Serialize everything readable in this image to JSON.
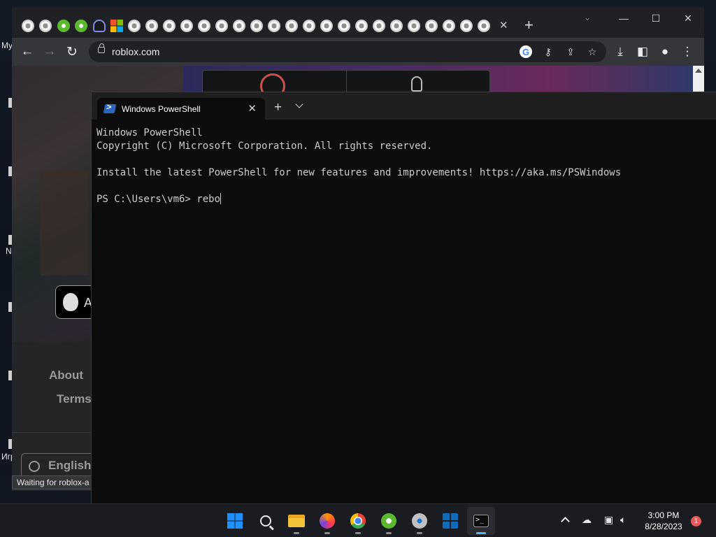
{
  "desktop": {
    "fragments": [
      "My",
      "N",
      "Игр"
    ]
  },
  "chrome": {
    "url": "roblox.com",
    "tab_close": "✕",
    "new_tab": "+",
    "window_controls": {
      "minimize": "—",
      "maximize": "☐",
      "close": "✕"
    },
    "page": {
      "app_store_letter": "A",
      "footer_links": [
        "About",
        "Terms"
      ],
      "language": "English",
      "status": "Waiting for roblox-a"
    }
  },
  "terminal": {
    "tab_title": "Windows PowerShell",
    "tab_close": "✕",
    "new_tab": "+",
    "lines": [
      "Windows PowerShell",
      "Copyright (C) Microsoft Corporation. All rights reserved.",
      "",
      "Install the latest PowerShell for new features and improvements! https://aka.ms/PSWindows",
      ""
    ],
    "prompt": "PS C:\\Users\\vm6> ",
    "input": "rebo"
  },
  "taskbar": {
    "apps": [
      "start-icon",
      "search-icon",
      "file-explorer-icon",
      "firefox-icon",
      "chrome-icon",
      "utorrent-icon",
      "settings-icon",
      "microsoft-store-icon",
      "terminal-icon"
    ],
    "time": "3:00 PM",
    "date": "8/28/2023",
    "notification_count": "1"
  },
  "colors": {
    "terminal_bg": "#0c0c0c",
    "terminal_text": "#cccccc",
    "taskbar_bg": "#1b1c21",
    "accent": "#5fb2f2"
  }
}
